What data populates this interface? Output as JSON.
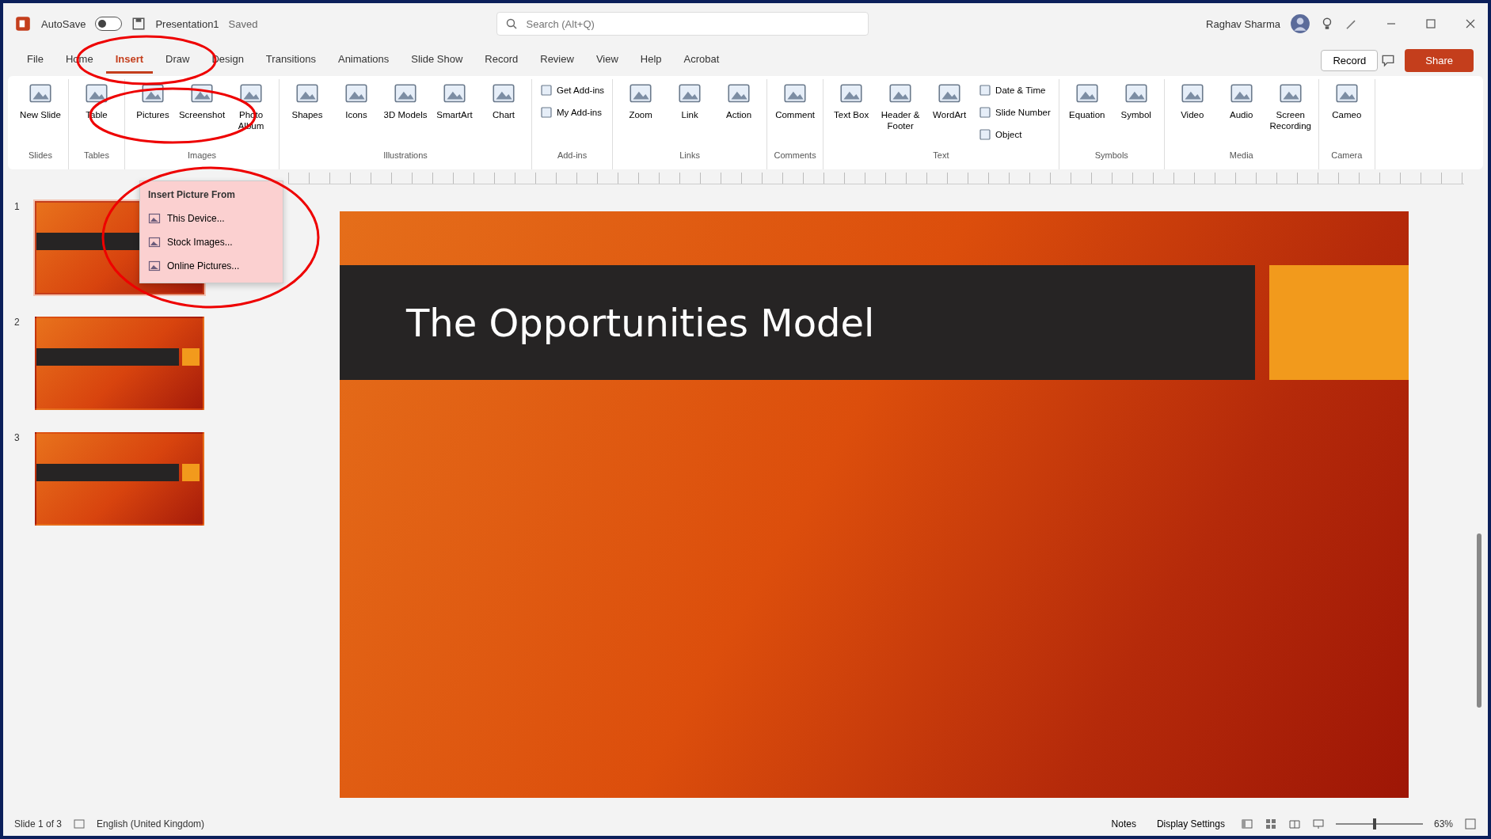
{
  "title_bar": {
    "autosave_label": "AutoSave",
    "autosave_on": false,
    "file_name": "Presentation1",
    "save_state": "Saved",
    "search": {
      "placeholder": "Search (Alt+Q)"
    },
    "user_name": "Raghav Sharma"
  },
  "tabs": [
    {
      "label": "File",
      "selected": false
    },
    {
      "label": "Home",
      "selected": false
    },
    {
      "label": "Insert",
      "selected": true
    },
    {
      "label": "Draw",
      "selected": false
    },
    {
      "label": "Design",
      "selected": false
    },
    {
      "label": "Transitions",
      "selected": false
    },
    {
      "label": "Animations",
      "selected": false
    },
    {
      "label": "Slide Show",
      "selected": false
    },
    {
      "label": "Record",
      "selected": false
    },
    {
      "label": "Review",
      "selected": false
    },
    {
      "label": "View",
      "selected": false
    },
    {
      "label": "Help",
      "selected": false
    },
    {
      "label": "Acrobat",
      "selected": false
    }
  ],
  "record_button": "Record",
  "share_button": "Share",
  "ribbon_groups": [
    {
      "name": "Slides",
      "items": [
        {
          "kind": "large",
          "label": "New Slide"
        }
      ]
    },
    {
      "name": "Tables",
      "items": [
        {
          "kind": "large",
          "label": "Table"
        }
      ]
    },
    {
      "name": "Images",
      "items": [
        {
          "kind": "large",
          "label": "Pictures"
        },
        {
          "kind": "large",
          "label": "Screenshot"
        },
        {
          "kind": "large",
          "label": "Photo Album"
        }
      ]
    },
    {
      "name": "Illustrations",
      "items": [
        {
          "kind": "large",
          "label": "Shapes"
        },
        {
          "kind": "large",
          "label": "Icons"
        },
        {
          "kind": "large",
          "label": "3D Models"
        },
        {
          "kind": "large",
          "label": "SmartArt"
        },
        {
          "kind": "large",
          "label": "Chart"
        }
      ]
    },
    {
      "name": "Add-ins",
      "items": [
        {
          "kind": "small",
          "label": "Get Add-ins"
        },
        {
          "kind": "small",
          "label": "My Add-ins"
        }
      ]
    },
    {
      "name": "Links",
      "items": [
        {
          "kind": "large",
          "label": "Zoom"
        },
        {
          "kind": "large",
          "label": "Link"
        },
        {
          "kind": "large",
          "label": "Action"
        }
      ]
    },
    {
      "name": "Comments",
      "items": [
        {
          "kind": "large",
          "label": "Comment"
        }
      ]
    },
    {
      "name": "Text",
      "items": [
        {
          "kind": "large",
          "label": "Text Box"
        },
        {
          "kind": "large",
          "label": "Header & Footer"
        },
        {
          "kind": "large",
          "label": "WordArt"
        },
        {
          "kind": "small",
          "label": "Date & Time"
        },
        {
          "kind": "small",
          "label": "Slide Number"
        },
        {
          "kind": "small",
          "label": "Object"
        }
      ]
    },
    {
      "name": "Symbols",
      "items": [
        {
          "kind": "large",
          "label": "Equation"
        },
        {
          "kind": "large",
          "label": "Symbol"
        }
      ]
    },
    {
      "name": "Media",
      "items": [
        {
          "kind": "large",
          "label": "Video"
        },
        {
          "kind": "large",
          "label": "Audio"
        },
        {
          "kind": "large",
          "label": "Screen Recording"
        }
      ]
    },
    {
      "name": "Camera",
      "items": [
        {
          "kind": "large",
          "label": "Cameo"
        }
      ]
    }
  ],
  "pictures_menu": {
    "heading": "Insert Picture From",
    "items": [
      "This Device...",
      "Stock Images...",
      "Online Pictures..."
    ]
  },
  "thumbnails": [
    {
      "number": "1",
      "selected": true
    },
    {
      "number": "2",
      "selected": false
    },
    {
      "number": "3",
      "selected": false
    }
  ],
  "slide": {
    "title": "The Opportunities Model"
  },
  "status_bar": {
    "slide_info": "Slide 1 of 3",
    "language": "English (United Kingdom)",
    "notes": "Notes",
    "display": "Display Settings",
    "zoom": {
      "level": 0.45,
      "reading": "63%"
    }
  }
}
